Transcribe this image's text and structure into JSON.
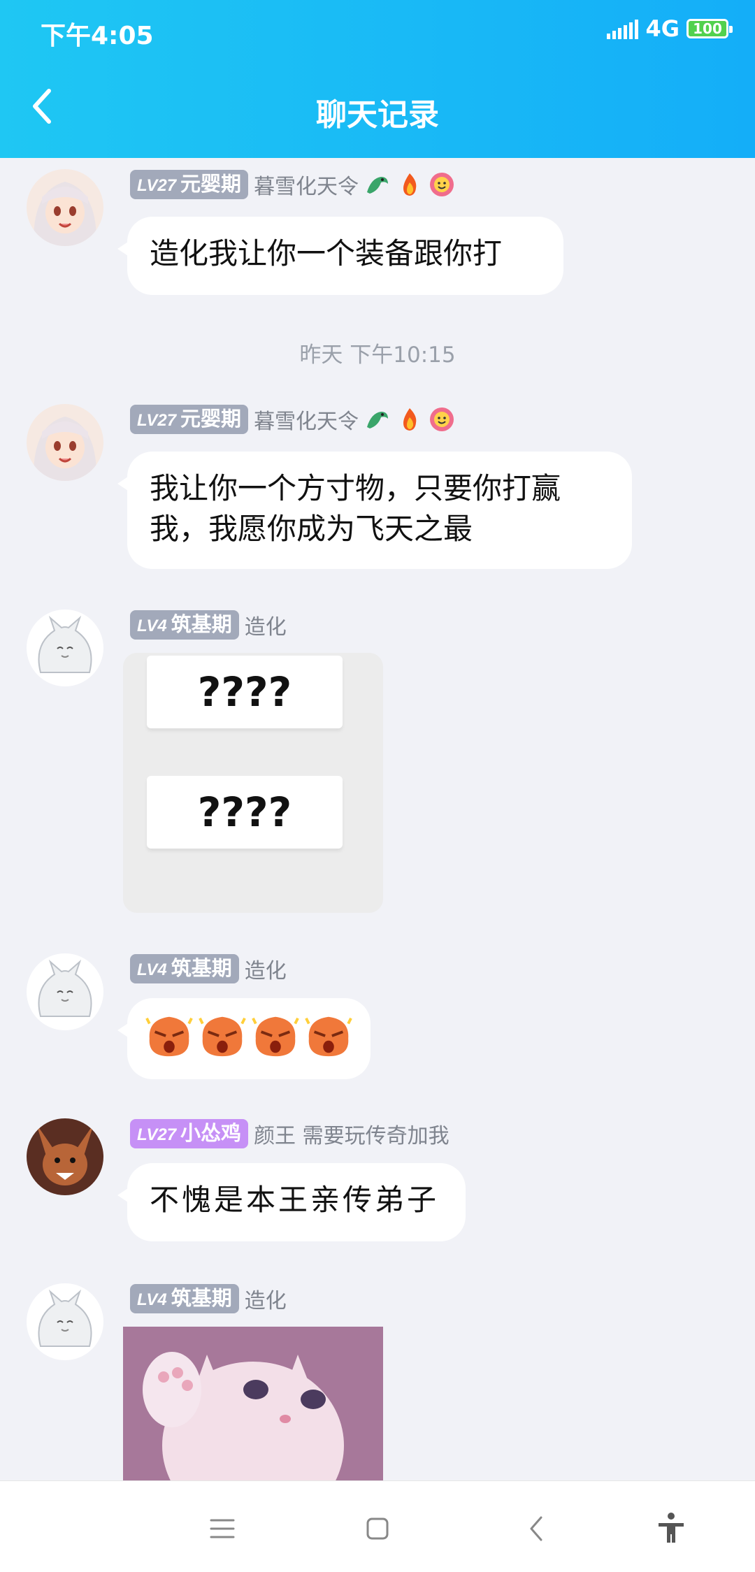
{
  "status_bar": {
    "time": "下午4:05",
    "network": "4G",
    "battery": "100"
  },
  "header": {
    "title": "聊天记录"
  },
  "messages": [
    {
      "level": "LV27",
      "rank": "元婴期",
      "nickname": "暮雪化天令",
      "text": "造化我让你一个装备跟你打"
    },
    {
      "level": "LV27",
      "rank": "元婴期",
      "nickname": "暮雪化天令",
      "text": "我让你一个方寸物，只要你打赢我，我愿你成为飞天之最"
    },
    {
      "level": "LV4",
      "rank": "筑基期",
      "nickname": "造化",
      "image_text": "????"
    },
    {
      "level": "LV4",
      "rank": "筑基期",
      "nickname": "造化",
      "sticker": "angry-face-emoji"
    },
    {
      "level": "LV27",
      "rank": "小怂鸡",
      "nickname": "颜王 需要玩传奇加我",
      "text": "不愧是本王亲传弟子"
    },
    {
      "level": "LV4",
      "rank": "筑基期",
      "nickname": "造化",
      "image": "crying-kitten-photo"
    }
  ],
  "time_separator": "昨天 下午10:15",
  "colors": {
    "header_start": "#1fc7f3",
    "header_end": "#14aef8",
    "badge_gray": "#a2a9ba",
    "badge_purple": "#c690f6",
    "background": "#f1f2f7"
  },
  "nav_icons": [
    "menu-icon",
    "home-icon",
    "back-nav-icon",
    "accessibility-icon"
  ]
}
